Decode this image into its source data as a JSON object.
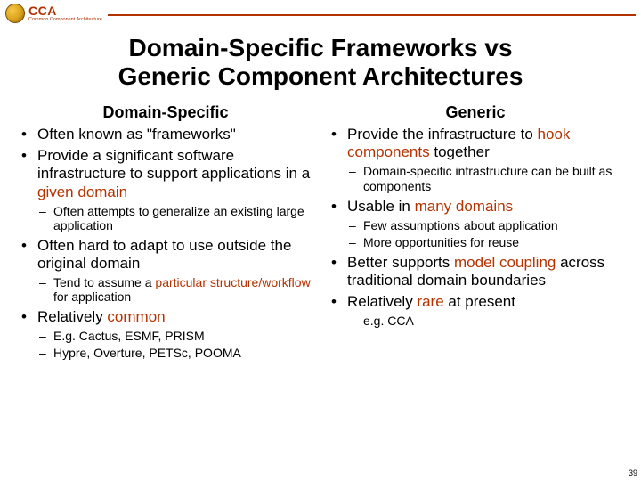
{
  "header": {
    "acronym": "CCA",
    "subtitle": "Common Component Architecture"
  },
  "title_line1": "Domain-Specific Frameworks vs",
  "title_line2": "Generic Component Architectures",
  "left": {
    "heading": "Domain-Specific",
    "b1": "Often known as \"frameworks\"",
    "b2a": "Provide a significant software infrastructure to support applications in a ",
    "b2b": "given domain",
    "b2s1": "Often attempts to generalize an existing large application",
    "b3": "Often hard to adapt to use outside the original domain",
    "b3s1a": "Tend to assume a ",
    "b3s1b": "particular structure/workflow",
    "b3s1c": " for application",
    "b4a": "Relatively ",
    "b4b": "common",
    "b4s1": "E.g. Cactus, ESMF, PRISM",
    "b4s2": "Hypre, Overture, PETSc, POOMA"
  },
  "right": {
    "heading": "Generic",
    "b1a": "Provide the infrastructure to ",
    "b1b": "hook components",
    "b1c": " together",
    "b1s1": "Domain-specific infrastructure can be built as components",
    "b2a": "Usable in ",
    "b2b": "many domains",
    "b2s1": "Few assumptions about application",
    "b2s2": "More opportunities for reuse",
    "b3a": "Better supports ",
    "b3b": "model coupling",
    "b3c": " across traditional domain boundaries",
    "b4a": "Relatively ",
    "b4b": "rare",
    "b4c": " at present",
    "b4s1": "e.g. CCA"
  },
  "slide_number": "39"
}
